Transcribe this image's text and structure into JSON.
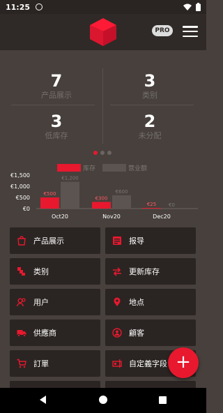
{
  "status_bar": {
    "time": "11:25"
  },
  "app_bar": {
    "badge": "PRO",
    "logo_icon": "red-cube-icon",
    "menu_icon": "hamburger-icon"
  },
  "stats": [
    {
      "value": "7",
      "label": "产品展示"
    },
    {
      "value": "3",
      "label": "类别"
    },
    {
      "value": "3",
      "label": "低库存"
    },
    {
      "value": "2",
      "label": "未分配"
    }
  ],
  "pager": {
    "count": 3,
    "active": 0
  },
  "legend": [
    {
      "label": "库存",
      "color": "#e8182e"
    },
    {
      "label": "营业额",
      "color": "#5b5451"
    }
  ],
  "chart_data": {
    "type": "bar",
    "categories": [
      "Oct20",
      "Nov20",
      "Dec20"
    ],
    "series": [
      {
        "name": "库存",
        "values": [
          500,
          300,
          25
        ],
        "labels": [
          "€500",
          "€300",
          "€25"
        ],
        "color": "#e8182e"
      },
      {
        "name": "营业额",
        "values": [
          1200,
          600,
          0
        ],
        "labels": [
          "€1,200",
          "€600",
          "€0"
        ],
        "color": "#5b5451"
      }
    ],
    "y_ticks": [
      "€0",
      "€500",
      "€1,000",
      "€1,500"
    ],
    "ylim": [
      0,
      1500
    ]
  },
  "menu": [
    {
      "label": "产品展示",
      "icon": "shopping-bag-icon"
    },
    {
      "label": "报导",
      "icon": "report-icon"
    },
    {
      "label": "类别",
      "icon": "category-icon"
    },
    {
      "label": "更新库存",
      "icon": "swap-arrows-icon"
    },
    {
      "label": "用户",
      "icon": "users-icon"
    },
    {
      "label": "地点",
      "icon": "location-pin-icon"
    },
    {
      "label": "供應商",
      "icon": "truck-icon"
    },
    {
      "label": "顧客",
      "icon": "customer-icon"
    },
    {
      "label": "訂單",
      "icon": "cart-icon"
    },
    {
      "label": "自定義字段",
      "icon": "custom-field-icon"
    }
  ],
  "fab_icon": "plus-icon",
  "accent_color": "#e8182e"
}
